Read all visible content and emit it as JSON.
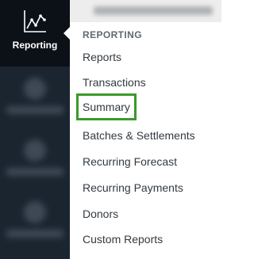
{
  "sidebar": {
    "active_item": {
      "label": "Reporting",
      "icon": "chart-line-icon"
    },
    "bg_color": "#1b2530",
    "active_bg_color": "#0c1117"
  },
  "menu": {
    "heading": "REPORTING",
    "items": [
      {
        "label": "Reports"
      },
      {
        "label": "Transactions"
      },
      {
        "label": "Summary",
        "highlighted": true
      },
      {
        "label": "Batches & Settlements"
      },
      {
        "label": "Recurring Forecast"
      },
      {
        "label": "Recurring Payments"
      },
      {
        "label": "Donors"
      },
      {
        "label": "Custom Reports"
      }
    ],
    "highlight_color": "#3a9a2a"
  }
}
